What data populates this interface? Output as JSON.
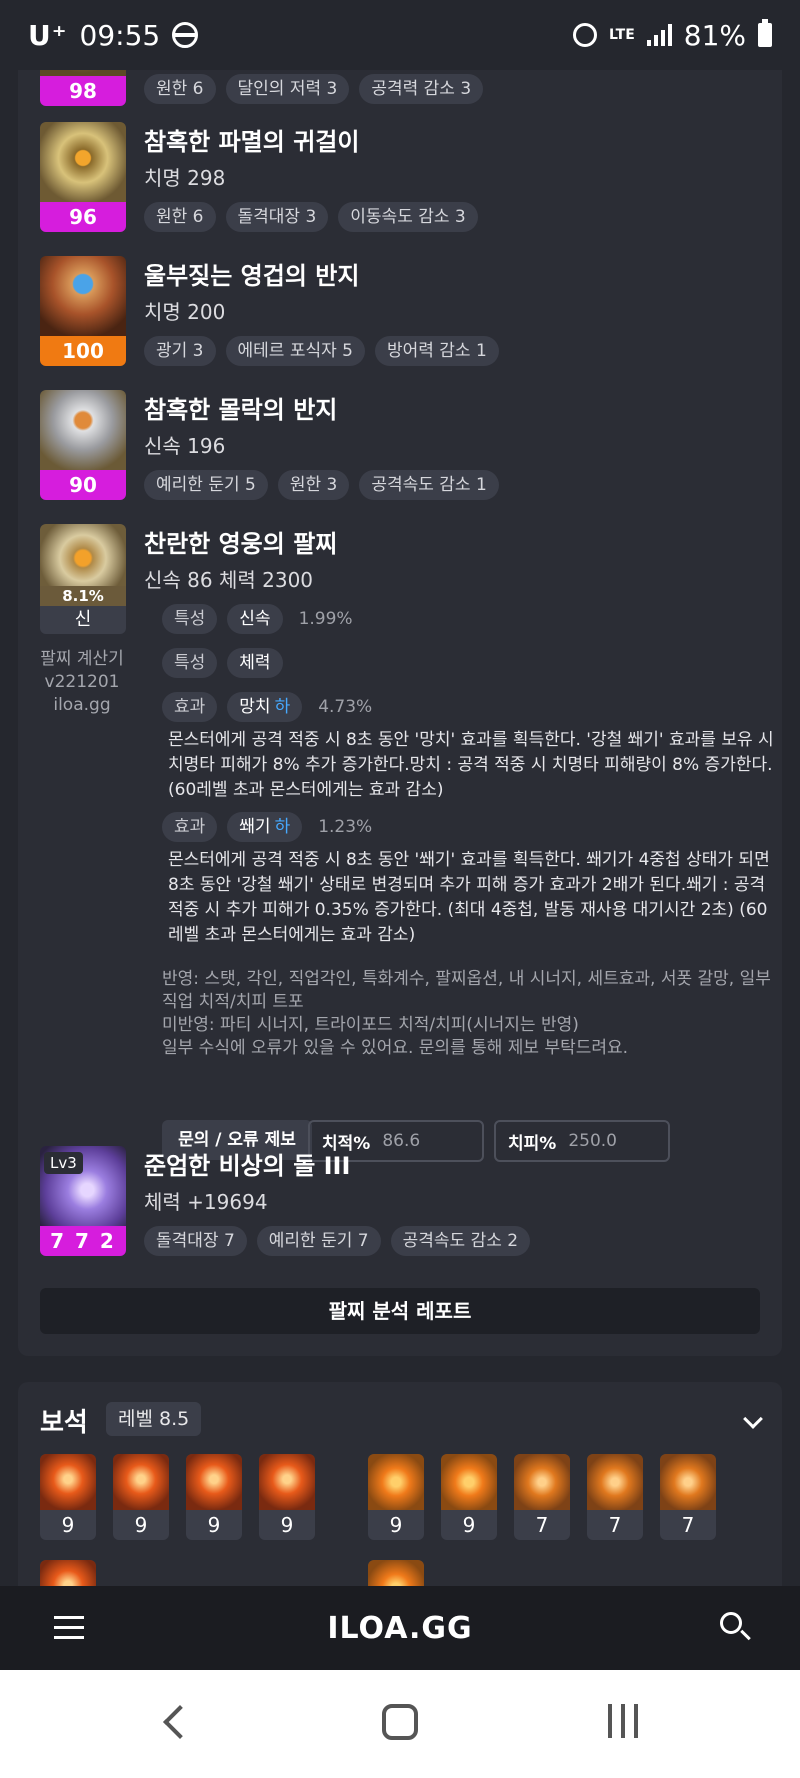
{
  "status_bar": {
    "carrier": "U⁺",
    "time": "09:55",
    "network": "LTE",
    "battery": "81%"
  },
  "items": [
    {
      "title": "",
      "stat": "",
      "quality": "98",
      "quality_color": "#d61ddd",
      "tags": [
        "원한 6",
        "달인의 저력 3",
        "공격력 감소 3"
      ]
    },
    {
      "title": "참혹한 파멸의 귀걸이",
      "stat": "치명 298",
      "quality": "96",
      "quality_color": "#d61ddd",
      "tags": [
        "원한 6",
        "돌격대장 3",
        "이동속도 감소 3"
      ]
    },
    {
      "title": "울부짖는 영겁의 반지",
      "stat": "치명 200",
      "quality": "100",
      "quality_color": "#f07a12",
      "tags": [
        "광기 3",
        "에테르 포식자 5",
        "방어력 감소 1"
      ]
    },
    {
      "title": "참혹한 몰락의 반지",
      "stat": "신속 196",
      "quality": "90",
      "quality_color": "#d61ddd",
      "tags": [
        "예리한 둔기 5",
        "원한 3",
        "공격속도 감소 1"
      ]
    }
  ],
  "bracelet": {
    "title": "찬란한 영웅의 팔찌",
    "stat": "신속 86  체력 2300",
    "percent": "8.1%",
    "grade": "신",
    "calculator": {
      "line1": "팔찌 계산기",
      "line2": "v221201",
      "line3": "iloa.gg"
    },
    "rows": [
      {
        "label": "특성",
        "value": "신속",
        "pct": "1.99%"
      },
      {
        "label": "특성",
        "value": "체력",
        "pct": ""
      }
    ],
    "effects": [
      {
        "label": "효과",
        "value": "망치",
        "grade": "하",
        "pct": "4.73%",
        "desc": "몬스터에게 공격 적중 시 8초 동안 '망치' 효과를 획득한다. '강철 쐐기' 효과를 보유 시 치명타 피해가 8% 추가 증가한다.망치 : 공격 적중 시 치명타 피해량이 8% 증가한다. (60레벨 초과 몬스터에게는 효과 감소)"
      },
      {
        "label": "효과",
        "value": "쐐기",
        "grade": "하",
        "pct": "1.23%",
        "desc": "몬스터에게 공격 적중 시 8초 동안 '쐐기' 효과를 획득한다. 쐐기가 4중첩 상태가 되면 8초 동안 '강철 쐐기' 상태로 변경되며 추가 피해 증가 효과가 2배가 된다.쐐기 : 공격 적중 시 추가 피해가 0.35% 증가한다. (최대 4중첩, 발동 재사용 대기시간 2초) (60레벨 초과 몬스터에게는 효과 감소)"
      }
    ],
    "info": [
      "반영: 스탯, 각인, 직업각인, 특화계수, 팔찌옵션, 내 시너지, 세트효과, 서폿 갈망, 일부 직업 치적/치피 트포",
      "미반영: 파티 시너지, 트라이포드 치적/치피(시너지는 반영)",
      "일부 수식에 오류가 있을 수 있어요. 문의를 통해 제보 부탁드려요."
    ],
    "report_button": "문의 / 오류 제보",
    "crit_rate": {
      "label": "치적%",
      "value": "86.6"
    },
    "crit_dmg": {
      "label": "치피%",
      "value": "250.0"
    }
  },
  "stone": {
    "level_badge": "Lv3",
    "title": "준엄한 비상의 돌 III",
    "stat": "체력 +19694",
    "quality": "7 7 2",
    "tags": [
      "돌격대장 7",
      "예리한 둔기 7",
      "공격속도 감소 2"
    ]
  },
  "analysis_button": "팔찌 분석 레포트",
  "gems": {
    "title": "보석",
    "level": "레벨 8.5",
    "values": [
      "9",
      "9",
      "9",
      "9",
      "9",
      "9",
      "7",
      "7",
      "7"
    ]
  },
  "appbar": {
    "logo": "ILOA.GG"
  }
}
